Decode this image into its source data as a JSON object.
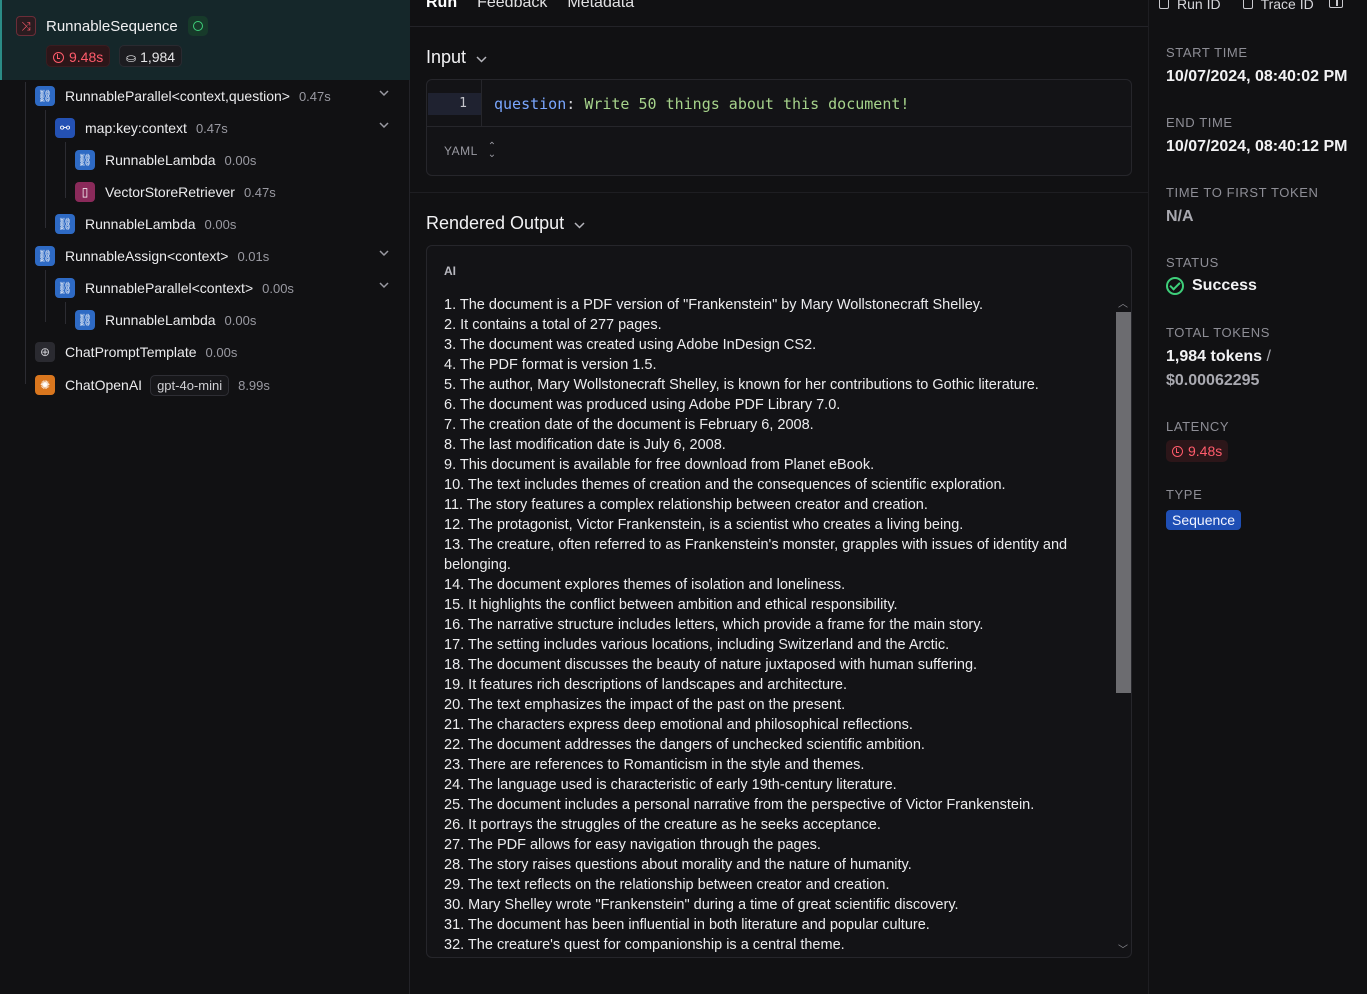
{
  "tree": {
    "root": {
      "name": "RunnableSequence",
      "latency": "9.48s",
      "tokens": "1,984"
    },
    "nodes": [
      {
        "name": "RunnableParallel<context,question>",
        "time": "0.47s"
      },
      {
        "name": "map:key:context",
        "time": "0.47s"
      },
      {
        "name": "RunnableLambda",
        "time": "0.00s"
      },
      {
        "name": "VectorStoreRetriever",
        "time": "0.47s"
      },
      {
        "name": "RunnableLambda",
        "time": "0.00s"
      },
      {
        "name": "RunnableAssign<context>",
        "time": "0.01s"
      },
      {
        "name": "RunnableParallel<context>",
        "time": "0.00s"
      },
      {
        "name": "RunnableLambda",
        "time": "0.00s"
      },
      {
        "name": "ChatPromptTemplate",
        "time": "0.00s"
      },
      {
        "name": "ChatOpenAI",
        "model": "gpt-4o-mini",
        "time": "8.99s"
      }
    ]
  },
  "tabs": [
    "Run",
    "Feedback",
    "Metadata"
  ],
  "input": {
    "title": "Input",
    "line_number": "1",
    "key": "question",
    "value": "Write 50 things about this document!",
    "format": "YAML"
  },
  "output": {
    "title": "Rendered Output",
    "role": "AI",
    "lines": [
      "1. The document is a PDF version of \"Frankenstein\" by Mary Wollstonecraft Shelley.",
      "2. It contains a total of 277 pages.",
      "3. The document was created using Adobe InDesign CS2.",
      "4. The PDF format is version 1.5.",
      "5. The author, Mary Wollstonecraft Shelley, is known for her contributions to Gothic literature.",
      "6. The document was produced using Adobe PDF Library 7.0.",
      "7. The creation date of the document is February 6, 2008.",
      "8. The last modification date is July 6, 2008.",
      "9. This document is available for free download from Planet eBook.",
      "10. The text includes themes of creation and the consequences of scientific exploration.",
      "11. The story features a complex relationship between creator and creation.",
      "12. The protagonist, Victor Frankenstein, is a scientist who creates a living being.",
      "13. The creature, often referred to as Frankenstein's monster, grapples with issues of identity and belonging.",
      "14. The document explores themes of isolation and loneliness.",
      "15. It highlights the conflict between ambition and ethical responsibility.",
      "16. The narrative structure includes letters, which provide a frame for the main story.",
      "17. The setting includes various locations, including Switzerland and the Arctic.",
      "18. The document discusses the beauty of nature juxtaposed with human suffering.",
      "19. It features rich descriptions of landscapes and architecture.",
      "20. The text emphasizes the impact of the past on the present.",
      "21. The characters express deep emotional and philosophical reflections.",
      "22. The document addresses the dangers of unchecked scientific ambition.",
      "23. There are references to Romanticism in the style and themes.",
      "24. The language used is characteristic of early 19th-century literature.",
      "25. The document includes a personal narrative from the perspective of Victor Frankenstein.",
      "26. It portrays the struggles of the creature as he seeks acceptance.",
      "27. The PDF allows for easy navigation through the pages.",
      "28. The story raises questions about morality and the nature of humanity.",
      "29. The text reflects on the relationship between creator and creation.",
      "30. Mary Shelley wrote \"Frankenstein\" during a time of great scientific discovery.",
      "31. The document has been influential in both literature and popular culture.",
      "32. The creature's quest for companionship is a central theme."
    ]
  },
  "meta": {
    "run_id_label": "Run ID",
    "trace_id_label": "Trace ID",
    "start_time_label": "START TIME",
    "start_time": "10/07/2024, 08:40:02 PM",
    "end_time_label": "END TIME",
    "end_time": "10/07/2024, 08:40:12 PM",
    "ttft_label": "TIME TO FIRST TOKEN",
    "ttft": "N/A",
    "status_label": "STATUS",
    "status": "Success",
    "total_tokens_label": "TOTAL TOKENS",
    "total_tokens": "1,984 tokens",
    "total_cost": "$0.00062295",
    "latency_label": "LATENCY",
    "latency": "9.48s",
    "type_label": "TYPE",
    "type": "Sequence"
  },
  "colors": {
    "background": "#111113",
    "selected_row": "#15272a",
    "latency_red": "#ff5b6b",
    "success_green": "#3ecf7a",
    "type_blue": "#1f4fb5"
  }
}
